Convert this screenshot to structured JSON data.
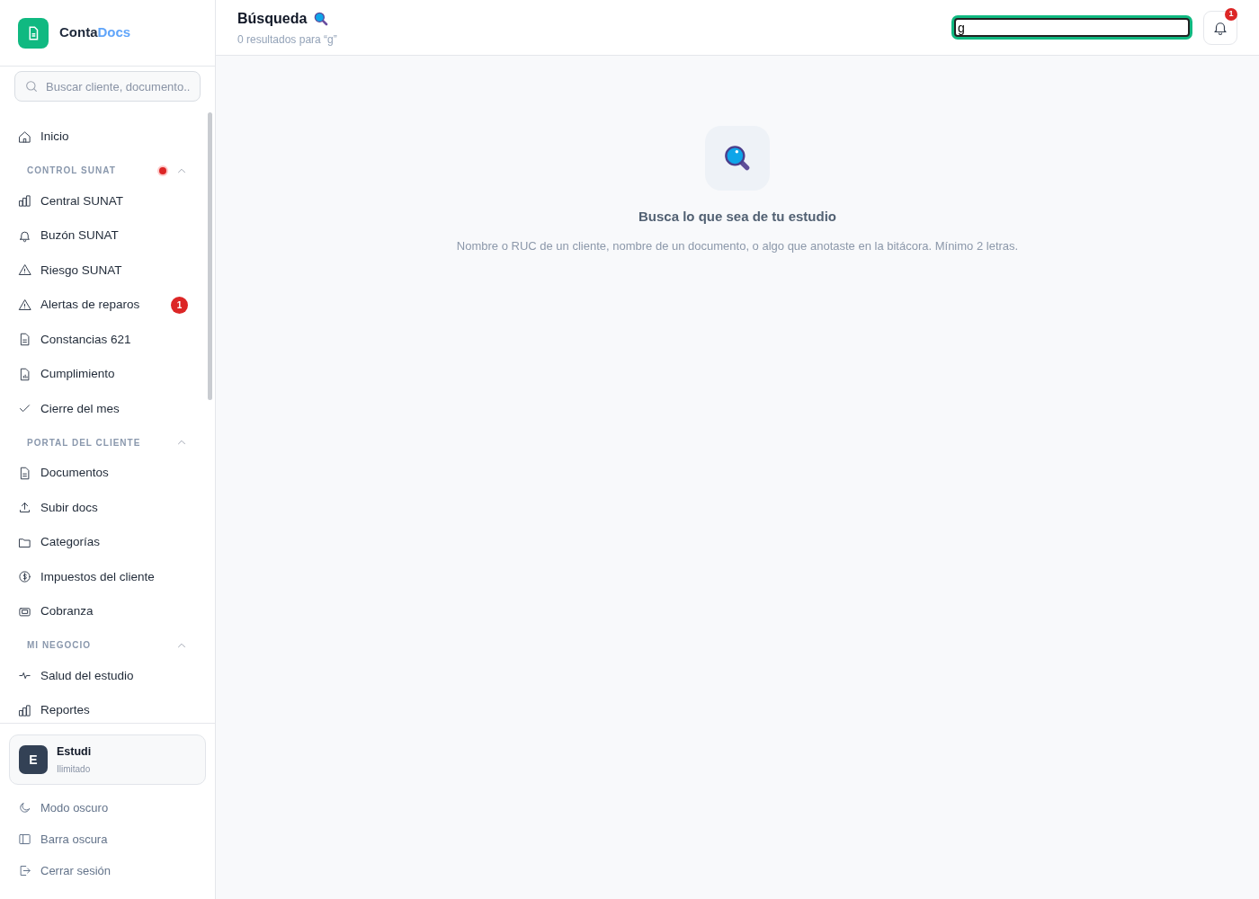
{
  "brand": {
    "name_part1": "Conta",
    "name_part2": "Docs"
  },
  "sidebar_search": {
    "placeholder": "Buscar cliente, documento.."
  },
  "nav": [
    {
      "kind": "item",
      "label": "Inicio"
    },
    {
      "kind": "section",
      "label": "CONTROL SUNAT",
      "expanded": true,
      "alert_dot": true,
      "items": [
        {
          "label": "Central SUNAT"
        },
        {
          "label": "Buzón SUNAT"
        },
        {
          "label": "Riesgo SUNAT"
        },
        {
          "label": "Alertas de reparos",
          "badge": "1"
        },
        {
          "label": "Constancias 621"
        },
        {
          "label": "Cumplimiento"
        },
        {
          "label": "Cierre del mes"
        }
      ]
    },
    {
      "kind": "section",
      "label": "PORTAL DEL CLIENTE",
      "expanded": true,
      "alert_dot": false,
      "items": [
        {
          "label": "Documentos"
        },
        {
          "label": "Subir docs"
        },
        {
          "label": "Categorías"
        },
        {
          "label": "Impuestos del cliente"
        },
        {
          "label": "Cobranza"
        }
      ]
    },
    {
      "kind": "section",
      "label": "MI NEGOCIO",
      "expanded": true,
      "alert_dot": false,
      "items": [
        {
          "label": "Salud del estudio"
        },
        {
          "label": "Reportes"
        }
      ]
    }
  ],
  "account": {
    "initial": "E",
    "name": "Estudi",
    "plan": "Ilimitado"
  },
  "footer_links": [
    {
      "label": "Modo oscuro"
    },
    {
      "label": "Barra oscura"
    },
    {
      "label": "Cerrar sesión"
    }
  ],
  "header": {
    "title": "Búsqueda",
    "subtitle": "0 resultados para “g”",
    "search_value": "g",
    "notification_count": "1"
  },
  "empty_state": {
    "title": "Busca lo que sea de tu estudio",
    "text": "Nombre o RUC de un cliente, nombre de un documento, o algo que anotaste en la bitácora. Mínimo 2 letras."
  }
}
